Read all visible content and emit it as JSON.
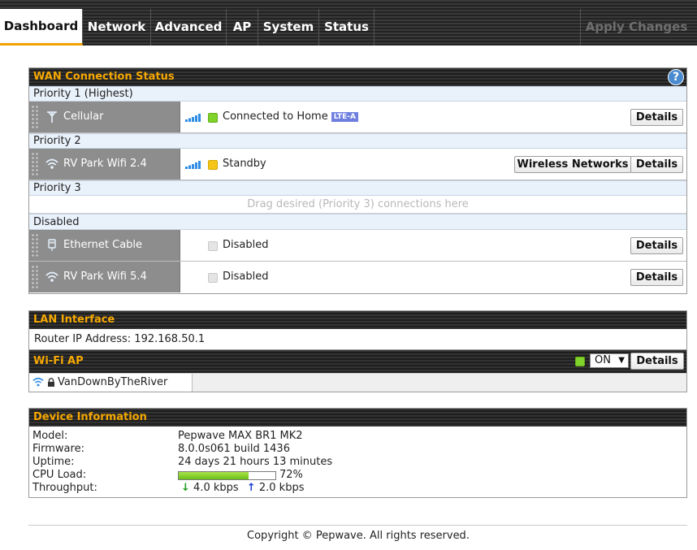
{
  "nav": {
    "tabs": [
      "Dashboard",
      "Network",
      "Advanced",
      "AP",
      "System",
      "Status"
    ],
    "active_tab": "Dashboard",
    "apply_label": "Apply Changes"
  },
  "wan": {
    "title": "WAN Connection Status",
    "help_label": "?",
    "priority1_label": "Priority 1 (Highest)",
    "priority2_label": "Priority 2",
    "priority3_label": "Priority 3",
    "disabled_label": "Disabled",
    "drag_hint": "Drag desired (Priority 3) connections here",
    "connections": [
      {
        "name": "Cellular",
        "icon": "cellular-antenna-icon",
        "status": "Connected to Home",
        "badge": "LTE-A",
        "led": "#7fd32a",
        "buttons": [
          "Details"
        ]
      },
      {
        "name": "RV Park Wifi 2.4",
        "icon": "wifi-icon",
        "status": "Standby",
        "led": "#f5c518",
        "buttons": [
          "Wireless Networks",
          "Details"
        ]
      },
      {
        "name": "Ethernet Cable",
        "icon": "ethernet-plug-icon",
        "status": "Disabled",
        "led": "#e4e4e4",
        "buttons": [
          "Details"
        ]
      },
      {
        "name": "RV Park Wifi 5.4",
        "icon": "wifi-icon",
        "status": "Disabled",
        "led": "#e4e4e4",
        "buttons": [
          "Details"
        ]
      }
    ]
  },
  "lan": {
    "title": "LAN Interface",
    "router_ip": "Router IP Address: 192.168.50.1"
  },
  "wifi_ap": {
    "title": "Wi-Fi AP",
    "state": "ON",
    "details_label": "Details",
    "ssid": "VanDownByTheRiver"
  },
  "device": {
    "title": "Device Information",
    "labels": {
      "model": "Model:",
      "firmware": "Firmware:",
      "uptime": "Uptime:",
      "cpu": "CPU Load:",
      "throughput": "Throughput:"
    },
    "model": "Pepwave MAX BR1 MK2",
    "firmware": "8.0.0s061 build 1436",
    "uptime": "24 days 21 hours 13 minutes",
    "cpu_load_percent": 72,
    "cpu_load_text": "72%",
    "download": "4.0 kbps",
    "upload": "2.0 kbps"
  },
  "footer": "Copyright © Pepwave. All rights reserved.",
  "colors": {
    "accent": "#f6a800",
    "brand_bar": "#222222",
    "led_ok": "#7fd32a",
    "led_standby": "#f5c518"
  }
}
